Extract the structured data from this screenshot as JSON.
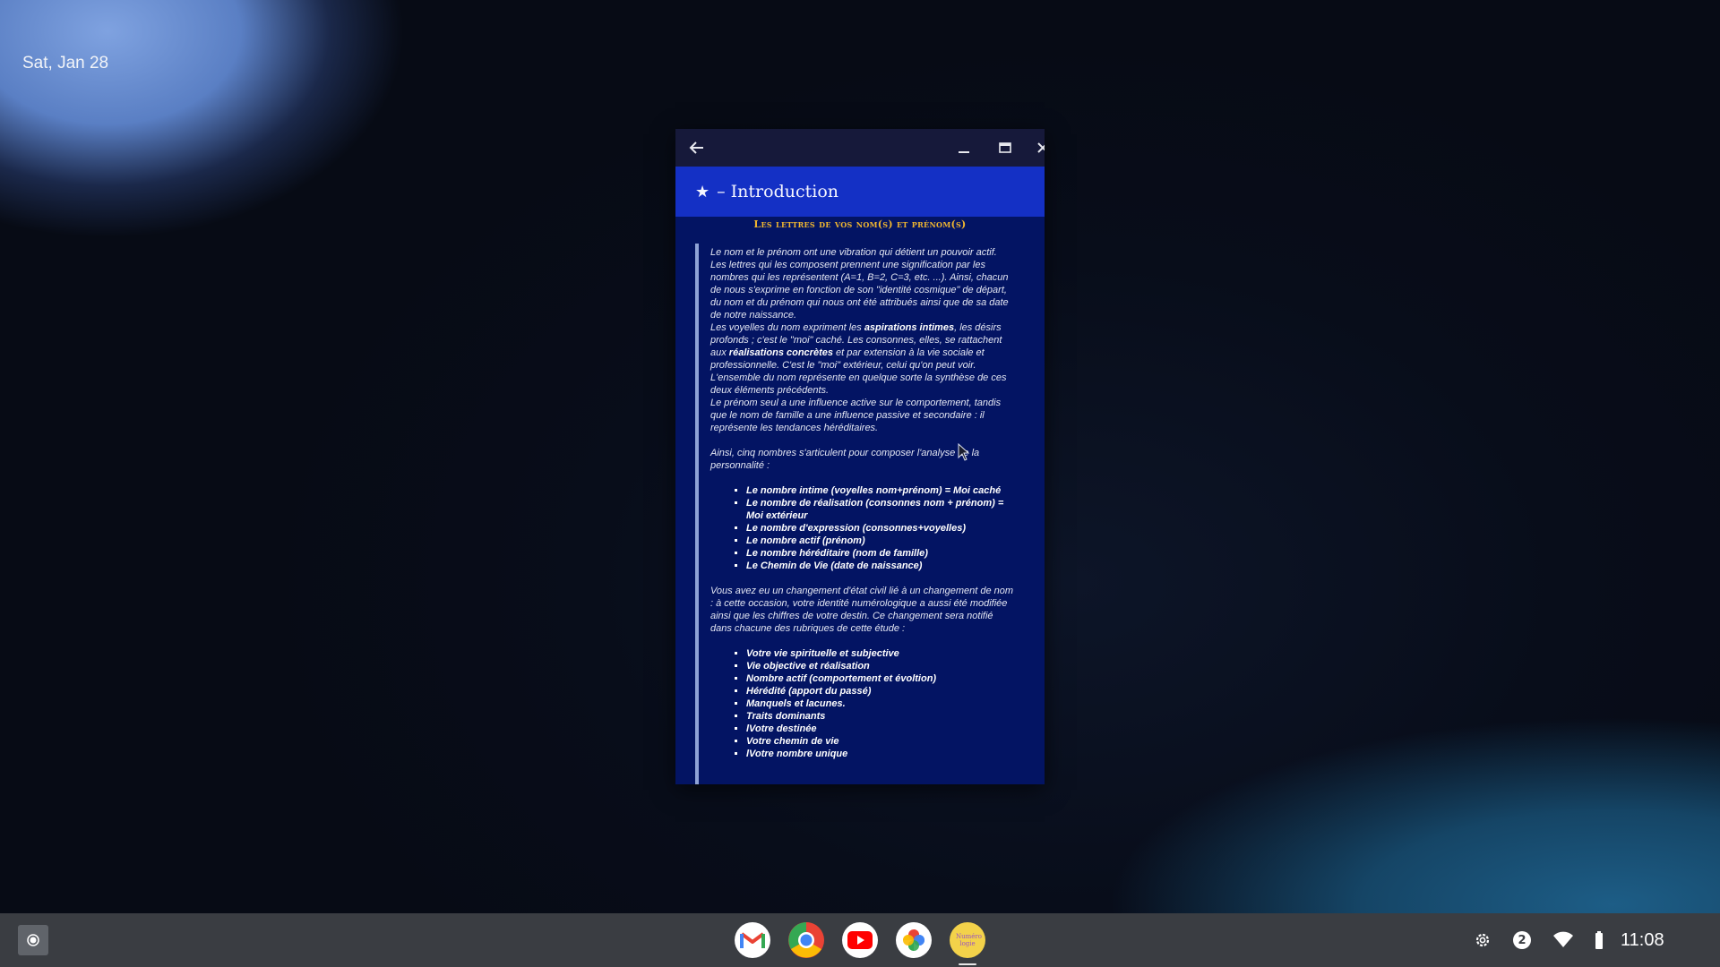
{
  "desktop": {
    "date": "Sat, Jan 28"
  },
  "window": {
    "header_star": "★",
    "header_title": "– Introduction",
    "subtitle": "Les lettres de vos nom(s) et prénom(s)",
    "paragraphs": {
      "p1": "Le nom et le prénom ont une vibration qui détient un pouvoir actif. Les lettres qui les composent prennent une signification par les nombres qui les représentent (A=1, B=2, C=3, etc. ...). Ainsi, chacun de nous s'exprime en fonction de son \"identité cosmique\" de départ, du nom et du prénom qui nous ont été attribués ainsi que de sa date de notre naissance.",
      "p2a": "Les voyelles du nom expriment les ",
      "p2b": "aspirations intimes",
      "p2c": ", les désirs profonds ; c'est le \"moi\" caché. Les consonnes, elles, se rattachent aux ",
      "p2d": "réalisations concrètes",
      "p2e": " et par extension à la vie sociale et professionnelle. C'est le \"moi\" extérieur, celui qu'on peut voir. L'ensemble du nom représente en quelque sorte la synthèse de ces deux éléments précédents.",
      "p3": "Le prénom seul a une influence active sur le comportement, tandis que le nom de famille a une influence passive et secondaire : il représente les tendances héréditaires.",
      "p4": "Ainsi, cinq nombres s'articulent pour composer l'analyse de la personnalité :",
      "p5": "Vous avez eu un changement d'état civil lié à un changement de nom : à cette occasion, votre identité numérologique a aussi été modifiée ainsi que les chiffres de votre destin. Ce changement sera notifié dans chacune des rubriques de cette étude :"
    },
    "list1": [
      "Le nombre intime (voyelles nom+prénom) = Moi caché",
      "Le nombre de réalisation (consonnes nom + prénom) = Moi extérieur",
      "Le nombre d'expression (consonnes+voyelles)",
      "Le nombre actif (prénom)",
      "Le nombre héréditaire (nom de famille)",
      "Le Chemin de Vie (date de naissance)"
    ],
    "list2": [
      "Votre vie spirituelle et subjective",
      "Vie objective et réalisation",
      "Nombre actif (comportement et évoltion)",
      "Hérédité (apport du passé)",
      "Manquels et lacunes.",
      "Traits dominants",
      "lVotre destinée",
      "Votre chemin de vie",
      "lVotre nombre unique"
    ]
  },
  "shelf": {
    "apps": [
      {
        "name": "Gmail",
        "icon": "gmail-icon"
      },
      {
        "name": "Chrome",
        "icon": "chrome-icon"
      },
      {
        "name": "YouTube",
        "icon": "youtube-icon"
      },
      {
        "name": "Photos",
        "icon": "photos-icon"
      },
      {
        "name": "Numérologie",
        "icon": "numerology-app-icon",
        "label": "Numéro logie"
      }
    ],
    "notification_count": "2",
    "time": "11:08"
  }
}
